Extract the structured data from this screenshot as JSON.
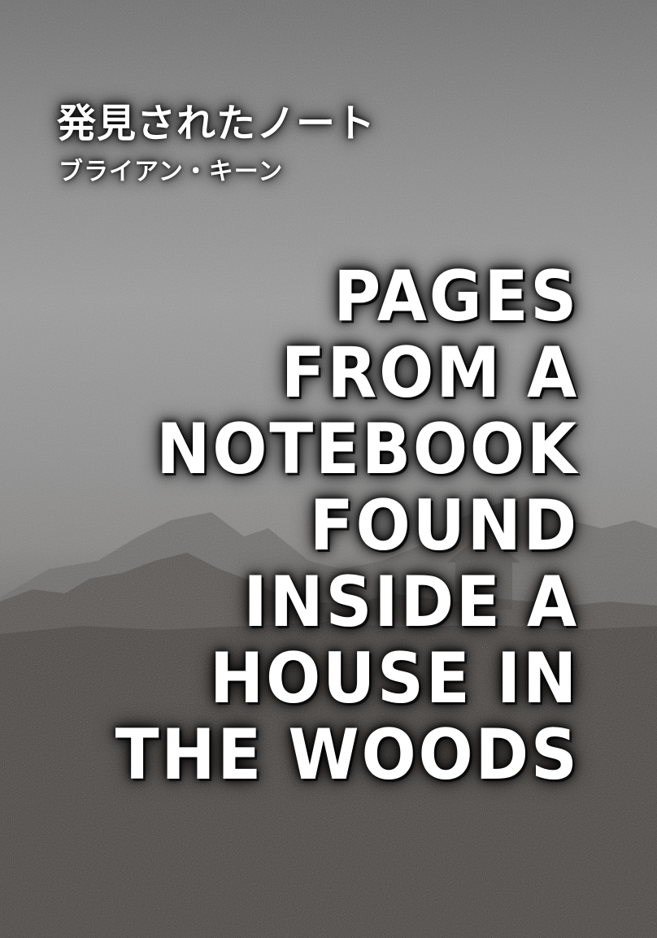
{
  "cover": {
    "japanese_title": "発見されたノート",
    "japanese_author": "ブライアン・キーン",
    "english_title_lines": [
      "PAGES",
      "FROM A",
      "NOTEBOOK",
      "FOUND",
      "INSIDE A",
      "HOUSE IN",
      "THE WOODS"
    ]
  },
  "colors": {
    "sky": "#8a8a8a",
    "hills": "#4a4644",
    "text": "#ffffff"
  }
}
